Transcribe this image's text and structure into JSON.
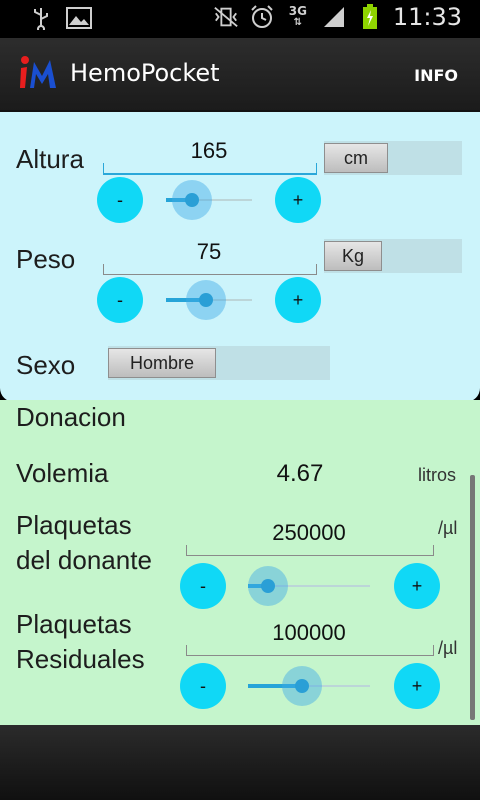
{
  "status_bar": {
    "time": "11:33",
    "network": "3G",
    "icons": [
      "usb-icon",
      "image-icon",
      "vibrate-icon",
      "alarm-icon",
      "signal-icon",
      "battery-charging-icon"
    ]
  },
  "action_bar": {
    "app_name": "HemoPocket",
    "info_label": "INFO"
  },
  "form": {
    "altura": {
      "label": "Altura",
      "value": "165",
      "unit": "cm",
      "slider_fraction": 0.3
    },
    "peso": {
      "label": "Peso",
      "value": "75",
      "unit": "Kg",
      "slider_fraction": 0.45
    },
    "sexo": {
      "label": "Sexo",
      "value": "Hombre"
    },
    "minus": "-",
    "plus": "+"
  },
  "results": {
    "donacion_label": "Donacion",
    "volemia": {
      "label": "Volemia",
      "value": "4.67",
      "unit": "litros"
    },
    "plaquetas_donante": {
      "label_line1": "Plaquetas",
      "label_line2": "del donante",
      "value": "250000",
      "unit": "/µl",
      "slider_fraction": 0.15
    },
    "plaquetas_residuales": {
      "label_line1": "Plaquetas",
      "label_line2": "Residuales",
      "value": "100000",
      "unit": "/µl",
      "slider_fraction": 0.45
    }
  },
  "colors": {
    "top_panel": "#ccf4fb",
    "bottom_panel": "#c5f5cc",
    "accent": "#10d8f6",
    "slider": "#26a4d8"
  }
}
